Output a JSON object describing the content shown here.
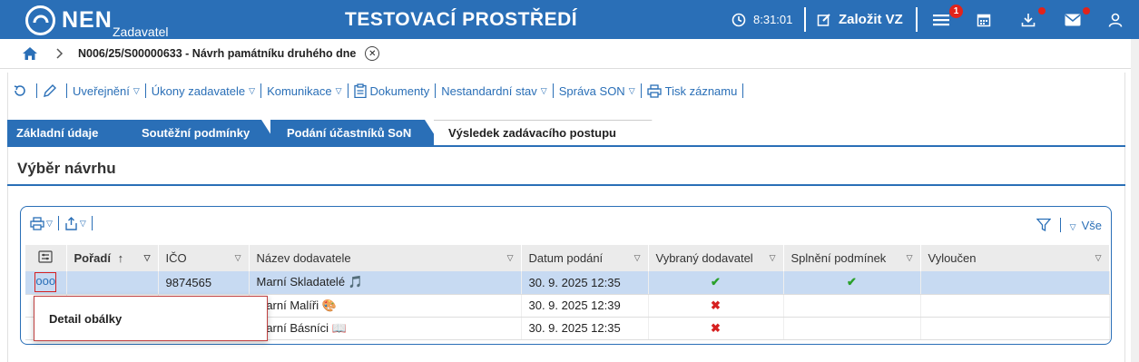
{
  "header": {
    "logo_text": "NEN",
    "logo_sub": "Zadavatel",
    "env_title": "TESTOVACÍ PROSTŘEDÍ",
    "time": "8:31:01",
    "create_label": "Založit VZ",
    "menu_badge": "1",
    "icons": [
      "clock-icon",
      "edit-icon",
      "menu-icon",
      "calendar-icon",
      "download-icon",
      "mail-icon",
      "user-icon"
    ],
    "accent": "#2a6fb7"
  },
  "breadcrumb": {
    "text": "N006/25/S00000633 - Návrh památníku druhého dne",
    "close": "✕"
  },
  "toolbar": {
    "items": [
      "Uveřejnění",
      "Úkony zadavatele",
      "Komunikace",
      "Dokumenty",
      "Nestandardní stav",
      "Správa SON",
      "Tisk záznamu"
    ]
  },
  "tabs": [
    "Základní údaje",
    "Soutěžní podmínky",
    "Podání účastníků SoN",
    "Výsledek zadávacího postupu"
  ],
  "section": {
    "title": "Výběr návrhu"
  },
  "grid": {
    "filter_label": "Vše",
    "columns": [
      "Pořadí",
      "IČO",
      "Název dodavatele",
      "Datum podání",
      "Vybraný dodavatel",
      "Splnění podmínek",
      "Vyloučen"
    ],
    "rows": [
      {
        "poradi": "",
        "ico": "9874565",
        "name": "Marní Skladatelé",
        "emoji": "🎵",
        "date": "30. 9. 2025 12:35",
        "selected": "✔",
        "conditions": "✔",
        "excluded": ""
      },
      {
        "poradi": "",
        "ico": "",
        "name": "Marní Malíři",
        "emoji": "🎨",
        "date": "30. 9. 2025 12:39",
        "selected": "✖",
        "conditions": "",
        "excluded": ""
      },
      {
        "poradi": "",
        "ico": "",
        "name": "Marní Básníci",
        "emoji": "📖",
        "date": "30. 9. 2025 12:35",
        "selected": "✖",
        "conditions": "",
        "excluded": ""
      }
    ],
    "row_menu": "ooo"
  },
  "context_menu": {
    "item": "Detail obálky"
  }
}
